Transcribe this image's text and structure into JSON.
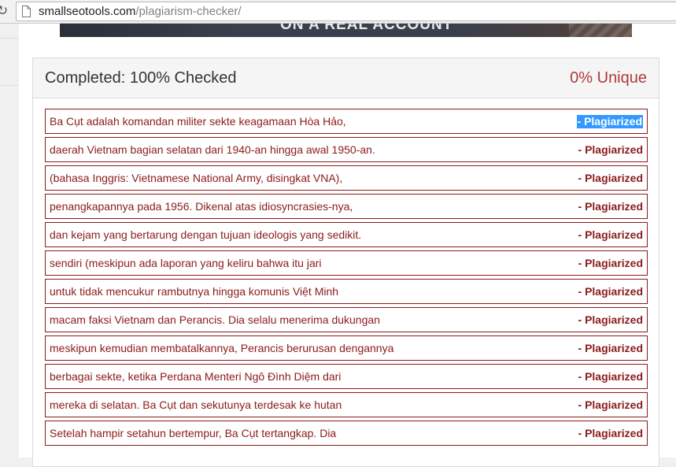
{
  "browser": {
    "url_domain": "smallseotools.com",
    "url_path": "/plagiarism-checker/"
  },
  "ad": {
    "text": "ON A REAL ACCOUNT"
  },
  "results": {
    "status_text": "Completed: 100% Checked",
    "unique_text": "0% Unique",
    "rows": [
      {
        "text": "Ba Cụt adalah komandan militer sekte keagamaan Hòa Hảo,",
        "status": "- Plagiarized"
      },
      {
        "text": "daerah Vietnam bagian selatan dari 1940-an hingga awal 1950-an.",
        "status": "- Plagiarized"
      },
      {
        "text": "(bahasa Inggris: Vietnamese National Army, disingkat VNA),",
        "status": "- Plagiarized"
      },
      {
        "text": "penangkapannya pada 1956. Dikenal atas idiosyncrasies-nya,",
        "status": "- Plagiarized"
      },
      {
        "text": "dan kejam yang bertarung dengan tujuan ideologis yang sedikit.",
        "status": "- Plagiarized"
      },
      {
        "text": "sendiri (meskipun ada laporan yang keliru bahwa itu jari",
        "status": "- Plagiarized"
      },
      {
        "text": "untuk tidak mencukur rambutnya hingga komunis Việt Minh",
        "status": "- Plagiarized"
      },
      {
        "text": "macam faksi Vietnam dan Perancis. Dia selalu menerima dukungan",
        "status": "- Plagiarized"
      },
      {
        "text": "meskipun kemudian membatalkannya, Perancis berurusan dengannya",
        "status": "- Plagiarized"
      },
      {
        "text": "berbagai sekte, ketika Perdana Menteri Ngô Đình Diệm dari",
        "status": "- Plagiarized"
      },
      {
        "text": "mereka di selatan. Ba Cụt dan sekutunya terdesak ke hutan",
        "status": "- Plagiarized"
      },
      {
        "text": "Setelah hampir setahun bertempur, Ba Cụt tertangkap. Dia",
        "status": "- Plagiarized"
      }
    ]
  },
  "colors": {
    "plagiarized": "#8b1a1a",
    "unique": "#b03a3a",
    "selection": "#3399ff"
  }
}
